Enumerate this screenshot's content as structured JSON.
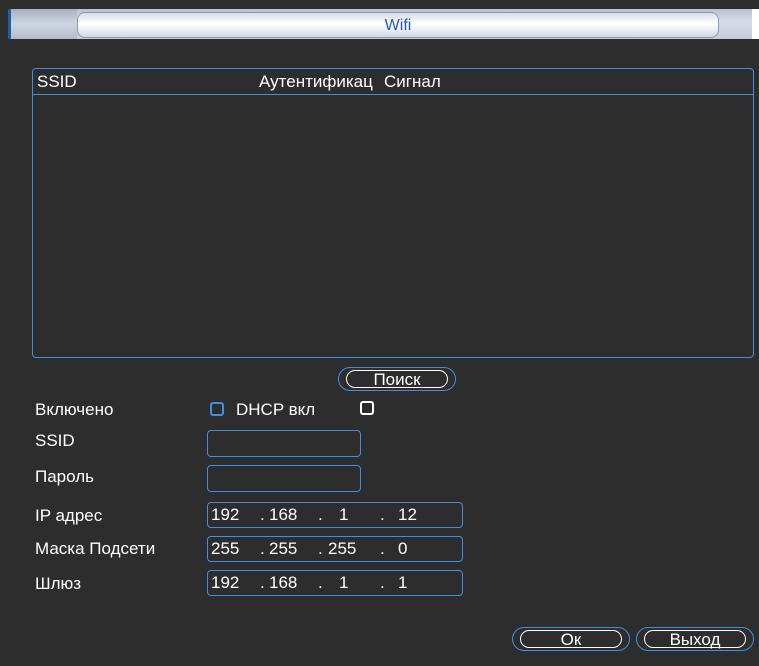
{
  "window": {
    "title": "Wifi"
  },
  "list": {
    "columns": [
      "SSID",
      "Аутентификац",
      "Сигнал"
    ]
  },
  "search_button": "Поиск",
  "form": {
    "enabled_label": "Включено",
    "dhcp_label": "DHCP вкл",
    "ssid_label": "SSID",
    "password_label": "Пароль",
    "ip_label": "IP адрес",
    "mask_label": "Маска Подсети",
    "gateway_label": "Шлюз",
    "ip": [
      "192",
      "168",
      "1",
      "12"
    ],
    "mask": [
      "255",
      "255",
      "255",
      "0"
    ],
    "gateway": [
      "192",
      "168",
      "1",
      "1"
    ],
    "dot": "."
  },
  "buttons": {
    "ok": "Ок",
    "exit": "Выход"
  },
  "colors": {
    "accent": "#3f8fe6",
    "background": "#2d2d2d",
    "title_text": "#2255cc"
  }
}
